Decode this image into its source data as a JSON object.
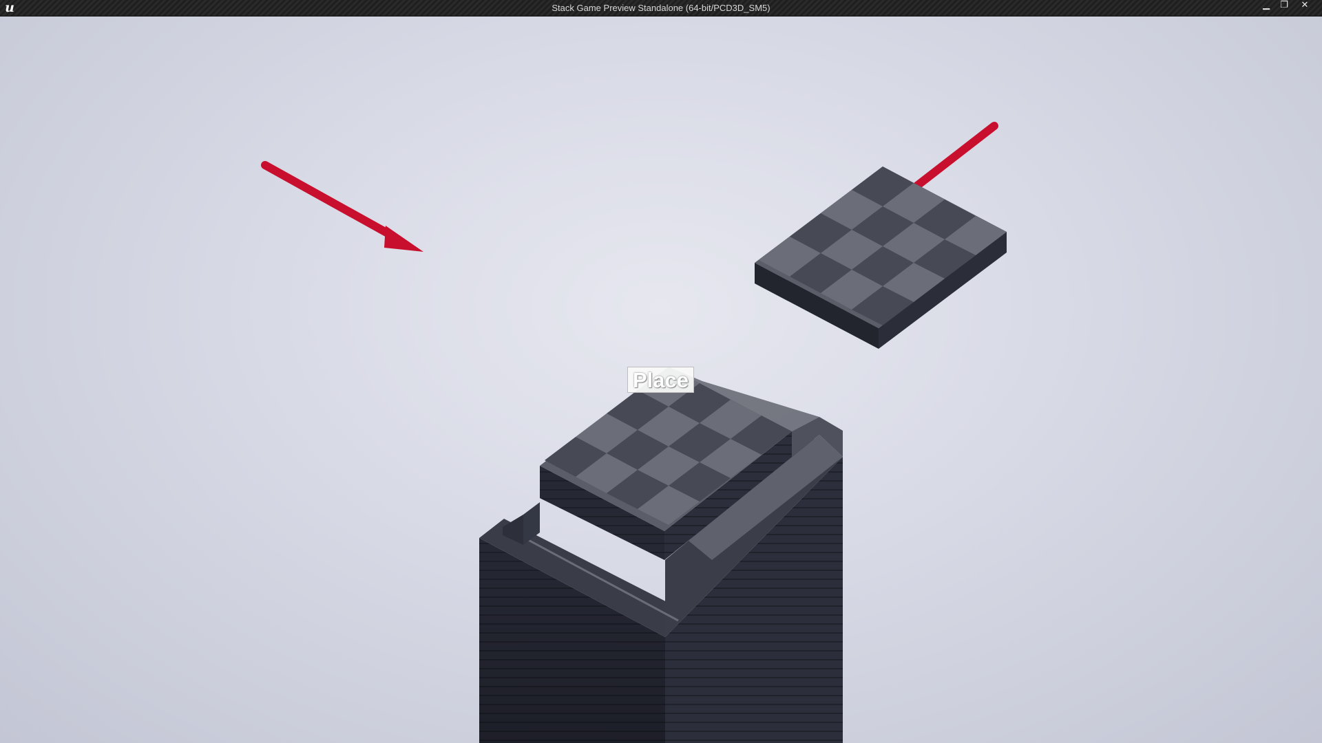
{
  "window": {
    "title": "Stack Game Preview Standalone (64-bit/PCD3D_SM5)",
    "logo_glyph": "u",
    "minimize_glyph": "▁",
    "maximize_glyph": "❐",
    "close_glyph": "✕"
  },
  "game": {
    "place_button_label": "Place"
  },
  "colors": {
    "arrow": "#c8102e",
    "block_top_light": "#6e717b",
    "block_top_dark": "#4b4e58",
    "block_side": "#23252f",
    "background": "#d7d9e5"
  },
  "icons": [
    "unreal-logo-icon",
    "minimize-icon",
    "maximize-icon",
    "close-icon",
    "arrow-icon"
  ]
}
